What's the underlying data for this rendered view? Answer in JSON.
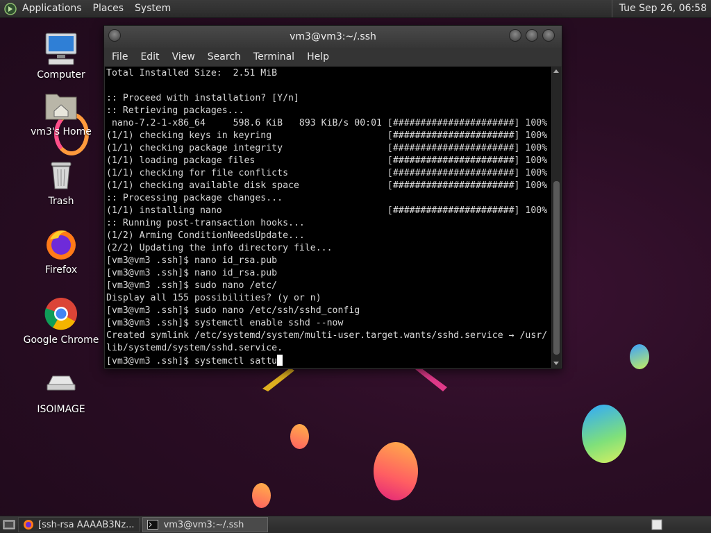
{
  "top_panel": {
    "menus": [
      "Applications",
      "Places",
      "System"
    ],
    "clock": "Tue Sep 26, 06:58"
  },
  "desktop_icons": [
    {
      "label": "Computer",
      "icon": "computer-icon"
    },
    {
      "label": "vm3's Home",
      "icon": "home-folder-icon"
    },
    {
      "label": "Trash",
      "icon": "trash-icon"
    },
    {
      "label": "Firefox",
      "icon": "firefox-icon"
    },
    {
      "label": "Google Chrome",
      "icon": "chrome-icon"
    },
    {
      "label": "ISOIMAGE",
      "icon": "drive-icon"
    }
  ],
  "terminal": {
    "title": "vm3@vm3:~/.ssh",
    "menu": [
      "File",
      "Edit",
      "View",
      "Search",
      "Terminal",
      "Help"
    ],
    "lines": [
      "Total Installed Size:  2.51 MiB",
      "",
      ":: Proceed with installation? [Y/n]",
      ":: Retrieving packages...",
      " nano-7.2-1-x86_64     598.6 KiB   893 KiB/s 00:01 [######################] 100%",
      "(1/1) checking keys in keyring                     [######################] 100%",
      "(1/1) checking package integrity                   [######################] 100%",
      "(1/1) loading package files                        [######################] 100%",
      "(1/1) checking for file conflicts                  [######################] 100%",
      "(1/1) checking available disk space                [######################] 100%",
      ":: Processing package changes...",
      "(1/1) installing nano                              [######################] 100%",
      ":: Running post-transaction hooks...",
      "(1/2) Arming ConditionNeedsUpdate...",
      "(2/2) Updating the info directory file...",
      "[vm3@vm3 .ssh]$ nano id_rsa.pub",
      "[vm3@vm3 .ssh]$ nano id_rsa.pub",
      "[vm3@vm3 .ssh]$ sudo nano /etc/",
      "Display all 155 possibilities? (y or n)",
      "[vm3@vm3 .ssh]$ sudo nano /etc/ssh/sshd_config",
      "[vm3@vm3 .ssh]$ systemctl enable sshd --now",
      "Created symlink /etc/systemd/system/multi-user.target.wants/sshd.service → /usr/",
      "lib/systemd/system/sshd.service.",
      "[vm3@vm3 .ssh]$ systemctl sattu"
    ]
  },
  "taskbar": {
    "items": [
      {
        "label": "[ssh-rsa AAAAB3Nz...",
        "icon": "firefox-icon",
        "active": false
      },
      {
        "label": "vm3@vm3:~/.ssh",
        "icon": "terminal-icon",
        "active": true
      }
    ]
  }
}
